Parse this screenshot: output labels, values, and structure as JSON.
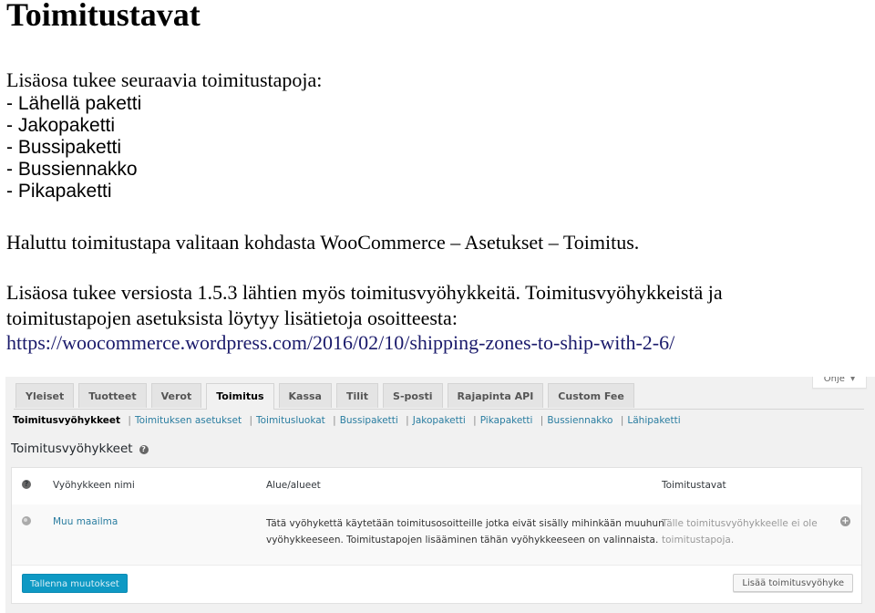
{
  "document": {
    "title": "Toimitustavat",
    "intro": "Lisäosa tukee seuraavia toimitustapoja:",
    "methods": [
      "- Lähellä paketti",
      "- Jakopaketti",
      "- Bussipaketti",
      "- Bussiennakko",
      "- Pikapaketti"
    ],
    "selection_note": "Haluttu toimitustapa valitaan kohdasta WooCommerce – Asetukset – Toimitus.",
    "zones_note_line1": "Lisäosa tukee versiosta 1.5.3 lähtien myös toimitusvyöhykkeitä. Toimitusvyöhykkeistä ja",
    "zones_note_line2": "toimitustapojen asetuksista löytyy lisätietoja osoitteesta:",
    "zones_link": "https://woocommerce.wordpress.com/2016/02/10/shipping-zones-to-ship-with-2-6/"
  },
  "screenshot": {
    "help_button": "Ohje",
    "help_caret": "▼",
    "tabs": [
      {
        "label": "Yleiset",
        "active": false
      },
      {
        "label": "Tuotteet",
        "active": false
      },
      {
        "label": "Verot",
        "active": false
      },
      {
        "label": "Toimitus",
        "active": true
      },
      {
        "label": "Kassa",
        "active": false
      },
      {
        "label": "Tilit",
        "active": false
      },
      {
        "label": "S-posti",
        "active": false
      },
      {
        "label": "Rajapinta API",
        "active": false
      },
      {
        "label": "Custom Fee",
        "active": false
      }
    ],
    "subnav": {
      "current": "Toimitusvyöhykkeet",
      "links": [
        "Toimituksen asetukset",
        "Toimitusluokat",
        "Bussipaketti",
        "Jakopaketti",
        "Pikapaketti",
        "Bussiennakko",
        "Lähipaketti"
      ],
      "separator": "|"
    },
    "section_title": "Toimitusvyöhykkeet",
    "help_icon": "?",
    "table": {
      "headers": {
        "icon": "?",
        "name": "Vyöhykkeen nimi",
        "regions": "Alue/alueet",
        "methods": "Toimitustavat"
      },
      "rows": [
        {
          "icon": "globe-icon",
          "name": "Muu maailma",
          "regions_line1": "Tätä vyöhykettä käytetään toimitusosoitteille jotka eivät sisälly mihinkään muuhun",
          "regions_line2": "vyöhykkeeseen. Toimitustapojen lisääminen tähän vyöhykkeeseen on valinnaista.",
          "methods_line1": "Tälle toimitusvyöhykkeelle ei ole",
          "methods_line2": "toimitustapoja.",
          "add_icon": "+"
        }
      ]
    },
    "save_button": "Tallenna muutokset",
    "add_zone_button": "Lisää toimitusvyöhyke"
  },
  "colors": {
    "link": "#2a7da0",
    "primary_button": "#0e99c4",
    "doc_link": "#1a1a6b"
  }
}
